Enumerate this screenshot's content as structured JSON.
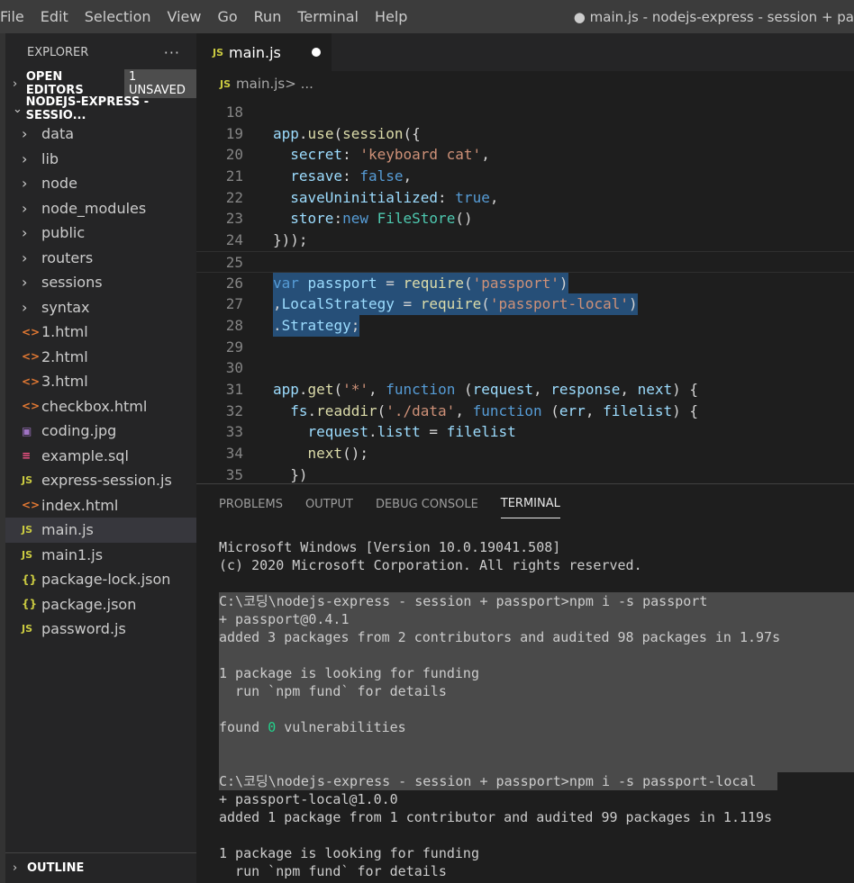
{
  "menu": [
    "File",
    "Edit",
    "Selection",
    "View",
    "Go",
    "Run",
    "Terminal",
    "Help"
  ],
  "window_title": "● main.js - nodejs-express - session + pa",
  "explorer": {
    "title": "EXPLORER",
    "more": "···",
    "open_editors": "OPEN EDITORS",
    "unsaved_badge": "1 UNSAVED",
    "project": "NODEJS-EXPRESS - SESSIO...",
    "items": [
      {
        "icon": "folder",
        "glyph": "›",
        "label": "data"
      },
      {
        "icon": "folder",
        "glyph": "›",
        "label": "lib"
      },
      {
        "icon": "folder",
        "glyph": "›",
        "label": "node"
      },
      {
        "icon": "folder",
        "glyph": "›",
        "label": "node_modules"
      },
      {
        "icon": "folder",
        "glyph": "›",
        "label": "public"
      },
      {
        "icon": "folder",
        "glyph": "›",
        "label": "routers"
      },
      {
        "icon": "folder",
        "glyph": "›",
        "label": "sessions"
      },
      {
        "icon": "folder",
        "glyph": "›",
        "label": "syntax"
      },
      {
        "icon": "html",
        "glyph": "<>",
        "label": "1.html"
      },
      {
        "icon": "html",
        "glyph": "<>",
        "label": "2.html"
      },
      {
        "icon": "html",
        "glyph": "<>",
        "label": "3.html"
      },
      {
        "icon": "html",
        "glyph": "<>",
        "label": "checkbox.html"
      },
      {
        "icon": "img",
        "glyph": "▣",
        "label": "coding.jpg"
      },
      {
        "icon": "sql",
        "glyph": "≡",
        "label": "example.sql"
      },
      {
        "icon": "js",
        "glyph": "JS",
        "label": "express-session.js"
      },
      {
        "icon": "html",
        "glyph": "<>",
        "label": "index.html"
      },
      {
        "icon": "js",
        "glyph": "JS",
        "label": "main.js",
        "active": true
      },
      {
        "icon": "js",
        "glyph": "JS",
        "label": "main1.js"
      },
      {
        "icon": "json",
        "glyph": "{}",
        "label": "package-lock.json"
      },
      {
        "icon": "json",
        "glyph": "{}",
        "label": "package.json"
      },
      {
        "icon": "js",
        "glyph": "JS",
        "label": "password.js"
      }
    ],
    "outline": "OUTLINE"
  },
  "editor": {
    "tab_label": "main.js",
    "tab_icon": "JS",
    "breadcrumb_file": "main.js",
    "breadcrumb_rest": " > ...",
    "lines": [
      {
        "n": "18",
        "tokens": []
      },
      {
        "n": "19",
        "tokens": [
          [
            "vr",
            "app"
          ],
          [
            "pn",
            "."
          ],
          [
            "fn",
            "use"
          ],
          [
            "pn",
            "("
          ],
          [
            "fn",
            "session"
          ],
          [
            "pn",
            "({"
          ]
        ]
      },
      {
        "n": "20",
        "tokens": [
          [
            "pn",
            "  "
          ],
          [
            "vr",
            "secret"
          ],
          [
            "pn",
            ": "
          ],
          [
            "st",
            "'keyboard cat'"
          ],
          [
            "pn",
            ","
          ]
        ]
      },
      {
        "n": "21",
        "tokens": [
          [
            "pn",
            "  "
          ],
          [
            "vr",
            "resave"
          ],
          [
            "pn",
            ": "
          ],
          [
            "kw",
            "false"
          ],
          [
            "pn",
            ","
          ]
        ]
      },
      {
        "n": "22",
        "tokens": [
          [
            "pn",
            "  "
          ],
          [
            "vr",
            "saveUninitialized"
          ],
          [
            "pn",
            ": "
          ],
          [
            "kw",
            "true"
          ],
          [
            "pn",
            ","
          ]
        ]
      },
      {
        "n": "23",
        "tokens": [
          [
            "pn",
            "  "
          ],
          [
            "vr",
            "store"
          ],
          [
            "pn",
            ":"
          ],
          [
            "kw",
            "new"
          ],
          [
            "pn",
            " "
          ],
          [
            "cl",
            "FileStore"
          ],
          [
            "pn",
            "()"
          ]
        ]
      },
      {
        "n": "24",
        "tokens": [
          [
            "pn",
            "}));"
          ]
        ]
      },
      {
        "n": "25",
        "tokens": [],
        "cursor": true
      },
      {
        "n": "26",
        "sel": true,
        "tokens": [
          [
            "kw",
            "var"
          ],
          [
            "pn",
            " "
          ],
          [
            "vr",
            "passport"
          ],
          [
            "pn",
            " = "
          ],
          [
            "fn",
            "require"
          ],
          [
            "pn",
            "("
          ],
          [
            "st",
            "'passport'"
          ],
          [
            "pn",
            ")"
          ]
        ]
      },
      {
        "n": "27",
        "sel": true,
        "tokens": [
          [
            "pn",
            ","
          ],
          [
            "vr",
            "LocalStrategy"
          ],
          [
            "pn",
            " = "
          ],
          [
            "fn",
            "require"
          ],
          [
            "pn",
            "("
          ],
          [
            "st",
            "'passport-local'"
          ],
          [
            "pn",
            ")"
          ]
        ]
      },
      {
        "n": "28",
        "sel": true,
        "tokens": [
          [
            "pn",
            "."
          ],
          [
            "vr",
            "Strategy"
          ],
          [
            "pn",
            ";"
          ]
        ]
      },
      {
        "n": "29",
        "tokens": []
      },
      {
        "n": "30",
        "tokens": []
      },
      {
        "n": "31",
        "tokens": [
          [
            "vr",
            "app"
          ],
          [
            "pn",
            "."
          ],
          [
            "fn",
            "get"
          ],
          [
            "pn",
            "("
          ],
          [
            "st",
            "'*'"
          ],
          [
            "pn",
            ", "
          ],
          [
            "kw",
            "function"
          ],
          [
            "pn",
            " ("
          ],
          [
            "vr",
            "request"
          ],
          [
            "pn",
            ", "
          ],
          [
            "vr",
            "response"
          ],
          [
            "pn",
            ", "
          ],
          [
            "vr",
            "next"
          ],
          [
            "pn",
            ") {"
          ]
        ]
      },
      {
        "n": "32",
        "tokens": [
          [
            "pn",
            "  "
          ],
          [
            "vr",
            "fs"
          ],
          [
            "pn",
            "."
          ],
          [
            "fn",
            "readdir"
          ],
          [
            "pn",
            "("
          ],
          [
            "st",
            "'./data'"
          ],
          [
            "pn",
            ", "
          ],
          [
            "kw",
            "function"
          ],
          [
            "pn",
            " ("
          ],
          [
            "vr",
            "err"
          ],
          [
            "pn",
            ", "
          ],
          [
            "vr",
            "filelist"
          ],
          [
            "pn",
            ") {"
          ]
        ]
      },
      {
        "n": "33",
        "tokens": [
          [
            "pn",
            "    "
          ],
          [
            "vr",
            "request"
          ],
          [
            "pn",
            "."
          ],
          [
            "vr",
            "listt"
          ],
          [
            "pn",
            " = "
          ],
          [
            "vr",
            "filelist"
          ]
        ]
      },
      {
        "n": "34",
        "tokens": [
          [
            "pn",
            "    "
          ],
          [
            "fn",
            "next"
          ],
          [
            "pn",
            "();"
          ]
        ]
      },
      {
        "n": "35",
        "tokens": [
          [
            "pn",
            "  })"
          ]
        ]
      }
    ]
  },
  "panel": {
    "tabs": [
      "PROBLEMS",
      "OUTPUT",
      "DEBUG CONSOLE",
      "TERMINAL"
    ],
    "active_tab": "TERMINAL",
    "lines": [
      {
        "text": "Microsoft Windows [Version 10.0.19041.508]"
      },
      {
        "text": "(c) 2020 Microsoft Corporation. All rights reserved."
      },
      {
        "text": ""
      },
      {
        "text": "C:\\코딩\\nodejs-express - session + passport>npm i -s passport",
        "sel": "wide"
      },
      {
        "text": "+ passport@0.4.1",
        "sel": "wide"
      },
      {
        "text": "added 3 packages from 2 contributors and audited 98 packages in 1.97s",
        "sel": "wide"
      },
      {
        "text": "",
        "sel": "wide"
      },
      {
        "text": "1 package is looking for funding",
        "sel": "wide"
      },
      {
        "text": "  run `npm fund` for details",
        "sel": "wide"
      },
      {
        "text": "",
        "sel": "wide"
      },
      {
        "pre": "found ",
        "num": "0",
        "post": " vulnerabilities",
        "sel": "wide"
      },
      {
        "text": "",
        "sel": "wide"
      },
      {
        "text": "",
        "sel": "wide"
      },
      {
        "text": "C:\\코딩\\nodejs-express - session + passport>npm i -s passport-local",
        "sel": "narrow"
      },
      {
        "text": "+ passport-local@1.0.0"
      },
      {
        "text": "added 1 package from 1 contributor and audited 99 packages in 1.119s"
      },
      {
        "text": ""
      },
      {
        "text": "1 package is looking for funding"
      },
      {
        "text": "  run `npm fund` for details"
      }
    ]
  }
}
